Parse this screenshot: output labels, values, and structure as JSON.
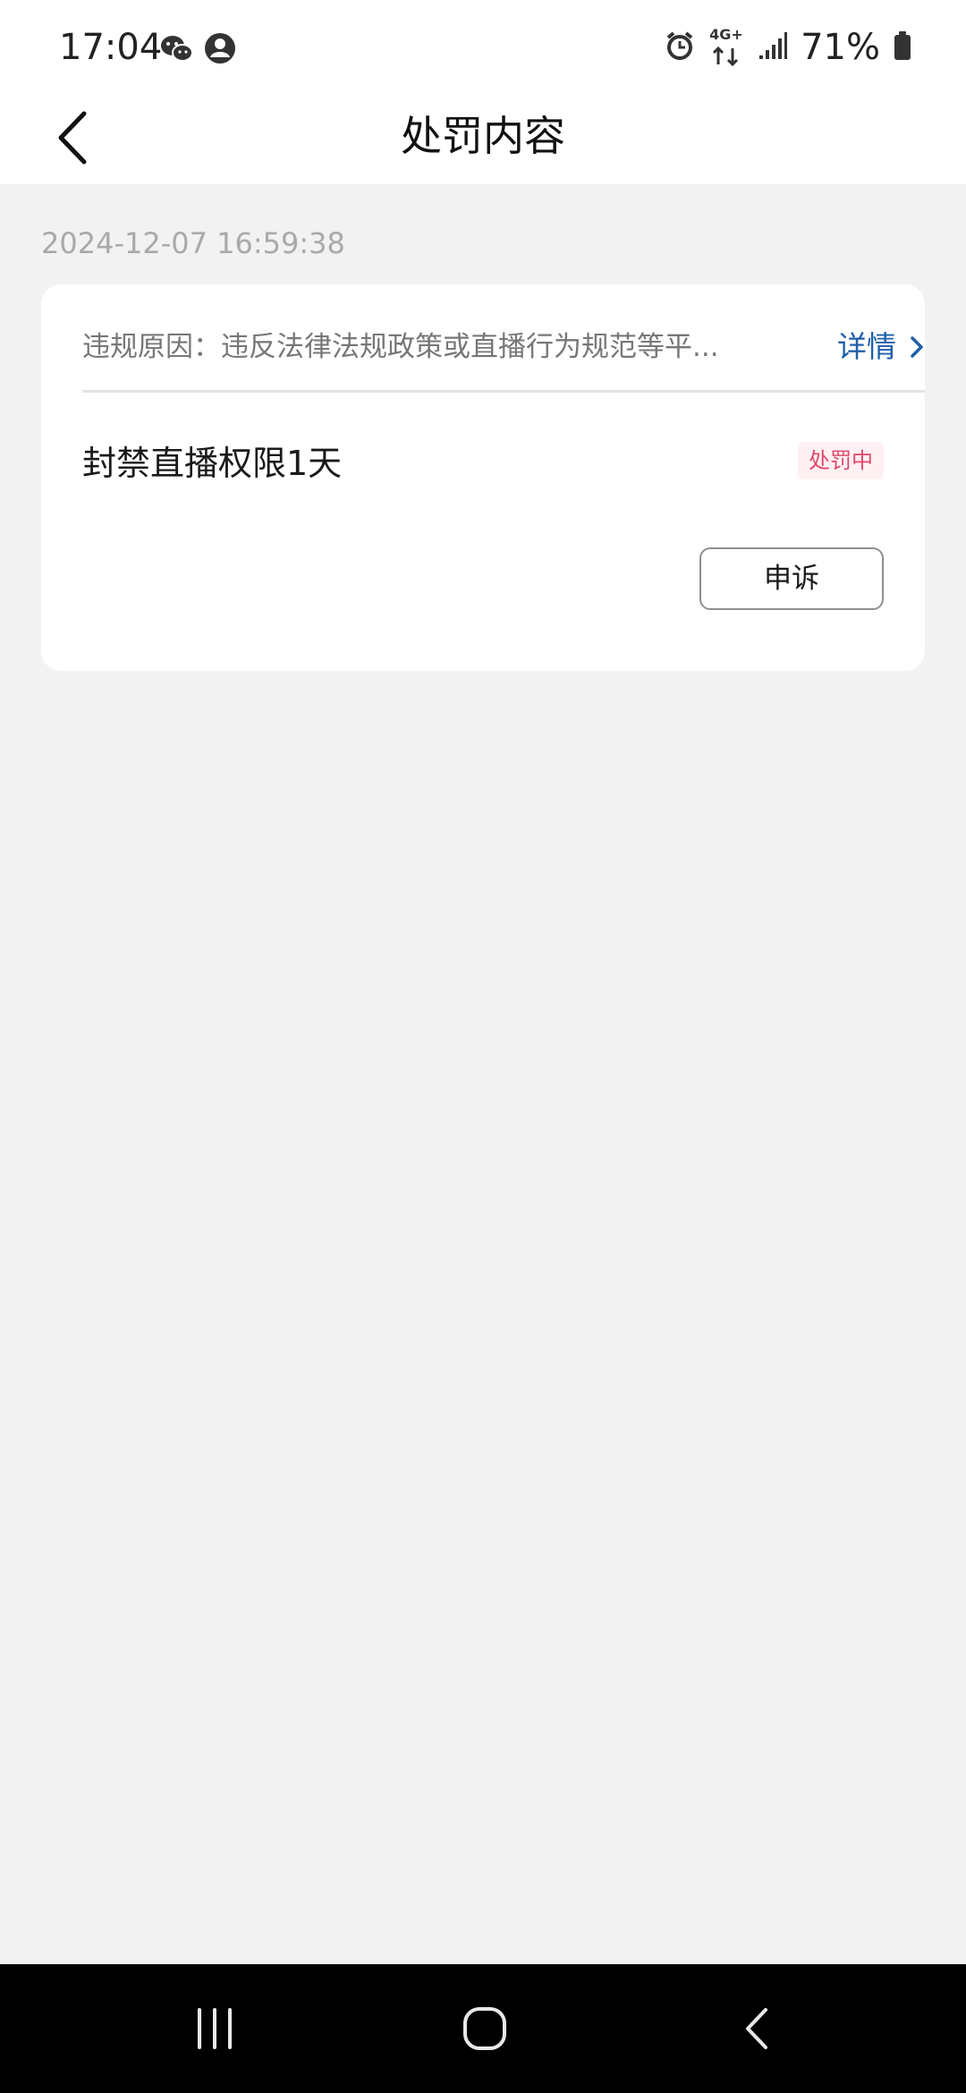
{
  "status_bar": {
    "time": "17:04",
    "left_icons": [
      "wechat-icon",
      "account-icon"
    ],
    "right_icons": [
      "alarm-icon",
      "network-4g-plus-icon",
      "signal-icon",
      "battery-icon"
    ],
    "network_label": "4G+",
    "battery": "71%"
  },
  "header": {
    "title": "处罚内容",
    "back_icon": "chevron-left-icon"
  },
  "record": {
    "timestamp": "2024-12-07 16:59:38",
    "reason_text": "违规原因：违反法律法规政策或直播行为规范等平...",
    "details_label": "详情",
    "penalty": "封禁直播权限1天",
    "status": "处罚中",
    "appeal_label": "申诉"
  },
  "colors": {
    "link": "#1f5fa8",
    "badge_text": "#e1486a",
    "badge_bg": "#fff1f3",
    "page_bg": "#f2f2f2"
  },
  "nav_bar": {
    "icons": [
      "recent-apps-icon",
      "home-icon",
      "back-icon"
    ]
  }
}
